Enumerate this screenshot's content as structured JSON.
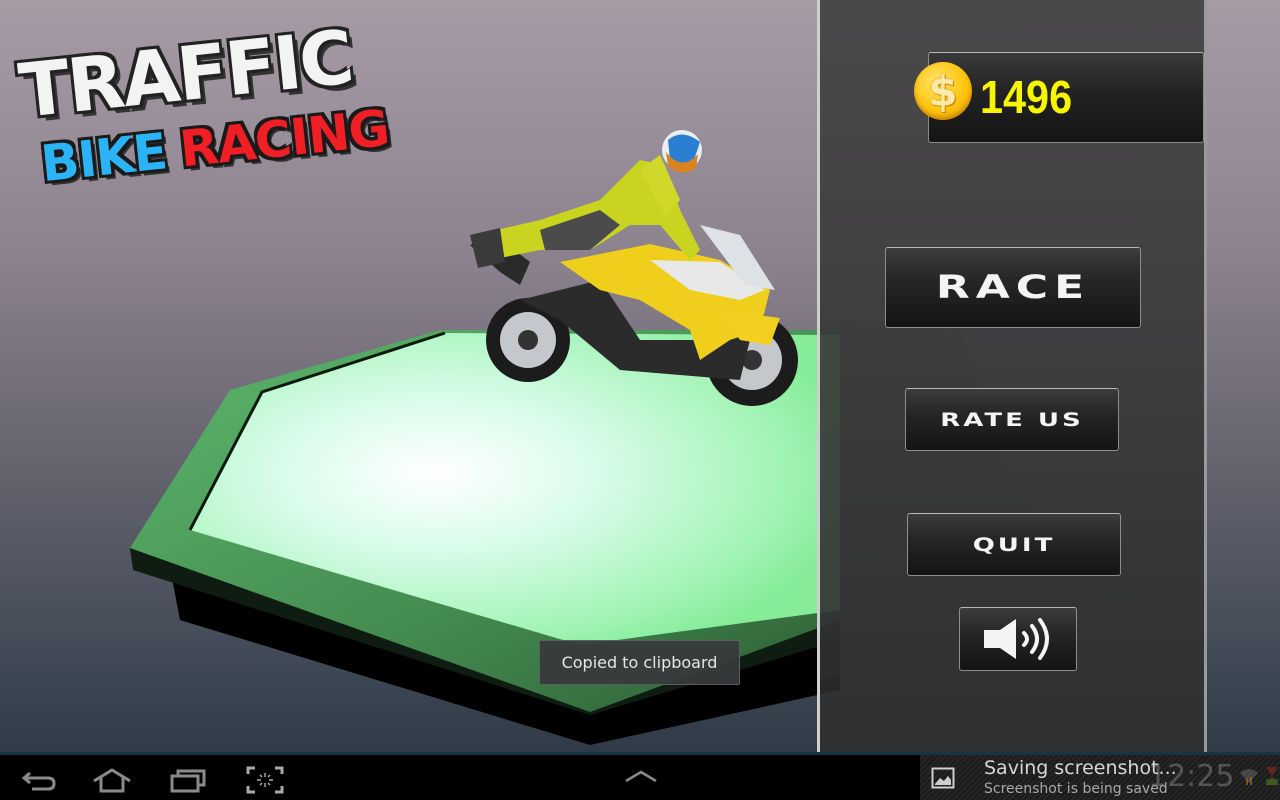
{
  "game": {
    "logo": {
      "line1": "TRAFFIC",
      "line2_word1": "BIKE",
      "line2_word2": "RACING"
    },
    "coins": {
      "icon": "dollar-coin-icon",
      "symbol": "$",
      "value": "1496"
    },
    "menu": {
      "race_label": "RACE",
      "rate_label": "RATE US",
      "quit_label": "QUIT",
      "sound_icon": "speaker-volume-icon"
    },
    "scene": {
      "description": "Rider on yellow sport motorcycle on green hexagonal platform"
    },
    "colors": {
      "coin_text": "#f8f500",
      "logo_bike": "#2ab4f5",
      "logo_racing": "#f01e25",
      "platform": "#4fa060"
    }
  },
  "toast": {
    "message": "Copied to clipboard"
  },
  "system_bar": {
    "nav": [
      {
        "name": "back",
        "icon": "back-icon"
      },
      {
        "name": "home",
        "icon": "home-icon"
      },
      {
        "name": "recent-apps",
        "icon": "recent-apps-icon"
      },
      {
        "name": "screenshot",
        "icon": "screenshot-icon"
      }
    ],
    "center_icon": "chevron-up-icon",
    "notification": {
      "title": "Saving screenshot...",
      "subtitle": "Screenshot is being saved",
      "clock": "12:25",
      "icons": [
        "image-icon",
        "wifi-icon",
        "battery-icon"
      ]
    }
  }
}
